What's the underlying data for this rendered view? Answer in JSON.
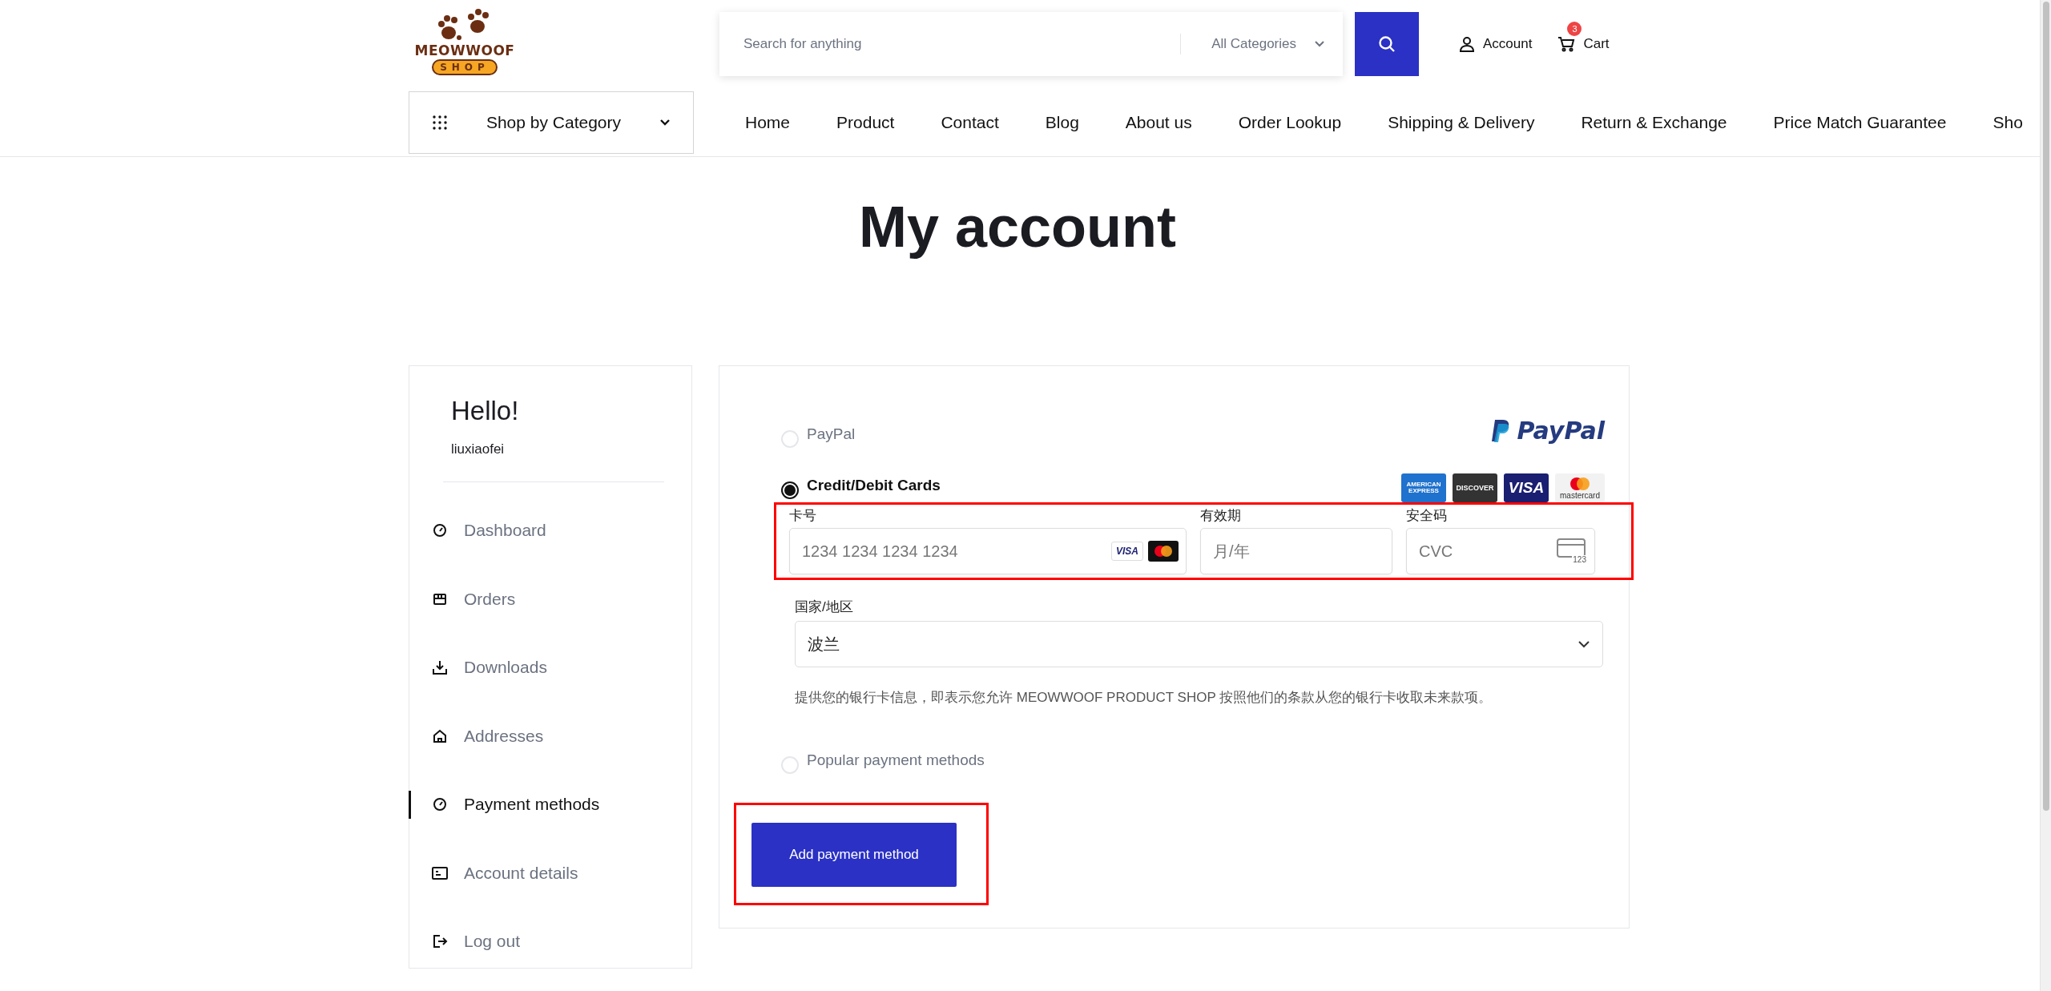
{
  "logo": {
    "title": "MEOWWOOF",
    "subtitle": "SHOP"
  },
  "search": {
    "placeholder": "Search for anything",
    "category": "All Categories"
  },
  "header_links": [
    {
      "kind": "account",
      "label": "Account"
    },
    {
      "kind": "cart",
      "label": "Cart",
      "badge": "3"
    }
  ],
  "category_menu": {
    "label": "Shop by Category"
  },
  "nav": [
    {
      "label": "Home"
    },
    {
      "label": "Product"
    },
    {
      "label": "Contact"
    },
    {
      "label": "Blog"
    },
    {
      "label": "About us"
    },
    {
      "label": "Order Lookup"
    },
    {
      "label": "Shipping & Delivery"
    },
    {
      "label": "Return & Exchange"
    },
    {
      "label": "Price Match Guarantee"
    },
    {
      "label": "Sho"
    }
  ],
  "page_title": "My account",
  "sidebar": {
    "greeting": "Hello!",
    "username": "liuxiaofei",
    "items": [
      {
        "kind": "gauge",
        "label": "Dashboard",
        "selected": false
      },
      {
        "kind": "box",
        "label": "Orders",
        "selected": false
      },
      {
        "kind": "download",
        "label": "Downloads",
        "selected": false
      },
      {
        "kind": "house",
        "label": "Addresses",
        "selected": false
      },
      {
        "kind": "gauge",
        "label": "Payment methods",
        "selected": true
      },
      {
        "kind": "idcard",
        "label": "Account details",
        "selected": false
      },
      {
        "kind": "logout",
        "label": "Log out",
        "selected": false
      }
    ]
  },
  "payment": {
    "options": [
      {
        "kind": "paypal",
        "label": "PayPal",
        "selected": false,
        "brand": "PayPal"
      },
      {
        "kind": "cards",
        "label": "Credit/Debit Cards",
        "selected": true,
        "brands": [
          {
            "kind": "amex",
            "text": "AMERICAN EXPRESS"
          },
          {
            "kind": "discover",
            "text": "DISCOVER"
          },
          {
            "kind": "visa",
            "text": "VISA"
          },
          {
            "kind": "mastercard",
            "text": "mastercard"
          }
        ]
      }
    ],
    "card_form": {
      "highlighted": true,
      "fields": [
        {
          "kind": "number",
          "label": "卡号",
          "placeholder": "1234 1234 1234 1234",
          "badge": "VISA"
        },
        {
          "kind": "expiry",
          "label": "有效期",
          "placeholder": "月/年"
        },
        {
          "kind": "cvc",
          "label": "安全码",
          "placeholder": "CVC",
          "badge": "123"
        }
      ]
    },
    "country": {
      "label": "国家/地区",
      "value": "波兰"
    },
    "notice": "提供您的银行卡信息，即表示您允许 MEOWWOOF PRODUCT SHOP 按照他们的条款从您的银行卡收取未来款项。",
    "more_options": [
      {
        "label": "Popular payment methods",
        "selected": false
      }
    ],
    "submit": {
      "label": "Add payment method",
      "highlighted": true
    }
  }
}
